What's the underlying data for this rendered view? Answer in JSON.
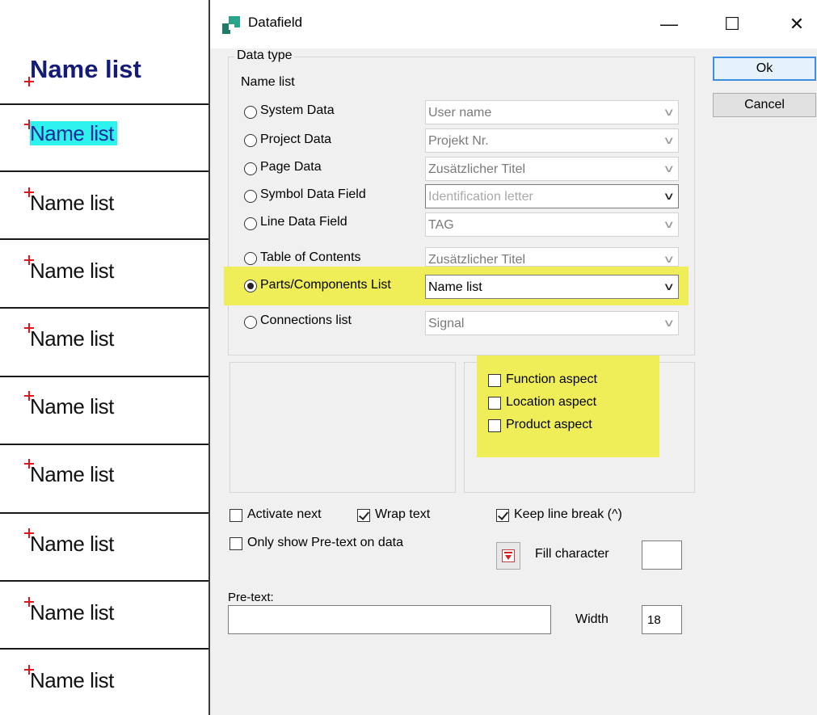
{
  "background": {
    "title": "Name list",
    "rows": [
      "Name list",
      "Name list",
      "Name list",
      "Name list",
      "Name list",
      "Name list",
      "Name list",
      "Name list",
      "Name list"
    ]
  },
  "dialog": {
    "title": "Datafield",
    "controls": {
      "minimize": "—",
      "maximize": "☐",
      "close": "✕"
    },
    "data_type_label": "Data type",
    "current_type": "Name list",
    "options": [
      {
        "label": "System Data",
        "value": "User name",
        "selected": false
      },
      {
        "label": "Project Data",
        "value": "Projekt Nr.",
        "selected": false
      },
      {
        "label": "Page Data",
        "value": "Zusätzlicher Titel",
        "selected": false
      },
      {
        "label": "Symbol Data Field",
        "value": "Identification letter",
        "selected": false
      },
      {
        "label": "Line Data Field",
        "value": "TAG",
        "selected": false
      },
      {
        "label": "Table of Contents",
        "value": "Zusätzlicher Titel",
        "selected": false
      },
      {
        "label": "Parts/Components List",
        "value": "Name list",
        "selected": true
      },
      {
        "label": "Connections list",
        "value": "Signal",
        "selected": false
      }
    ],
    "aspects": [
      {
        "label": "Function aspect",
        "checked": false
      },
      {
        "label": "Location aspect",
        "checked": false
      },
      {
        "label": "Product aspect",
        "checked": false
      }
    ],
    "options_row": {
      "activate_next": {
        "label": "Activate next",
        "checked": false
      },
      "wrap_text": {
        "label": "Wrap text",
        "checked": true
      },
      "keep_line_break": {
        "label": "Keep line break (^)",
        "checked": true
      },
      "only_show_pretext": {
        "label": "Only show Pre-text on data",
        "checked": false
      }
    },
    "fill_character_label": "Fill character",
    "fill_character_value": "",
    "pretext_label": "Pre-text:",
    "pretext_value": "",
    "width_label": "Width",
    "width_value": "18",
    "ok_label": "Ok",
    "cancel_label": "Cancel",
    "highlight_color": "#f0ee58"
  }
}
